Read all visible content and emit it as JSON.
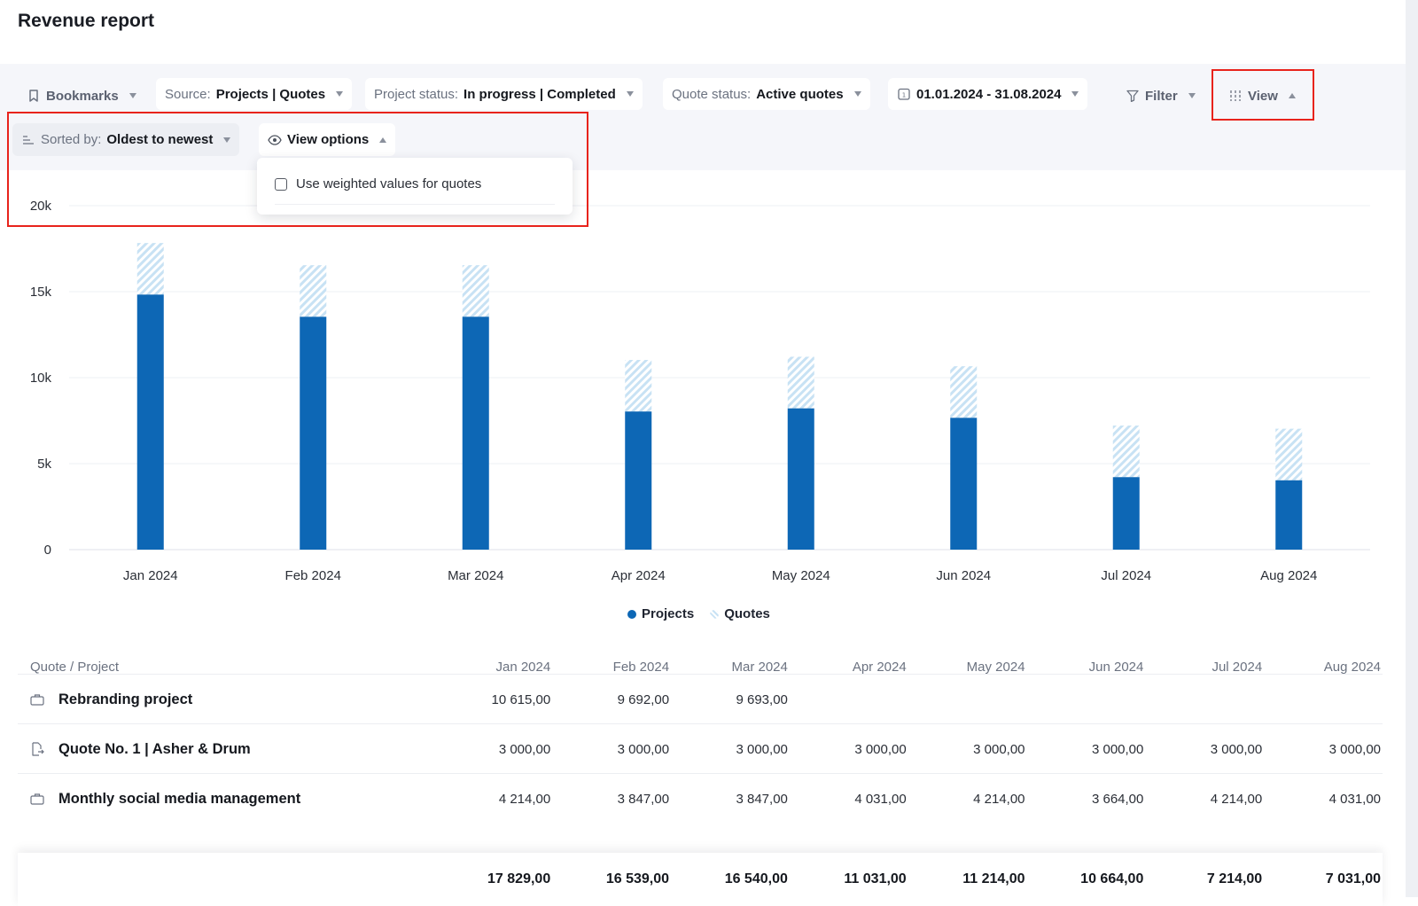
{
  "page": {
    "title": "Revenue report"
  },
  "toolbar": {
    "bookmarks": "Bookmarks",
    "source": {
      "label": "Source:",
      "value": "Projects | Quotes"
    },
    "project_status": {
      "label": "Project status:",
      "value": "In progress | Completed"
    },
    "quote_status": {
      "label": "Quote status:",
      "value": "Active quotes"
    },
    "date_range": "01.01.2024 - 31.08.2024",
    "filter": "Filter",
    "view": "View",
    "sorted_by": {
      "label": "Sorted by:",
      "value": "Oldest to newest"
    },
    "view_options": "View options"
  },
  "view_options_menu": {
    "weighted_option": "Use weighted values for quotes",
    "checked": false
  },
  "colors": {
    "projects": "#0d67b5",
    "quotes": "#c8e2f4",
    "highlight": "#e8231c"
  },
  "chart_data": {
    "type": "bar",
    "stacked": true,
    "categories": [
      "Jan 2024",
      "Feb 2024",
      "Mar 2024",
      "Apr 2024",
      "May 2024",
      "Jun 2024",
      "Jul 2024",
      "Aug 2024"
    ],
    "series": [
      {
        "name": "Projects",
        "values": [
          14829,
          13539,
          13540,
          8031,
          8214,
          7664,
          4214,
          4031
        ]
      },
      {
        "name": "Quotes",
        "values": [
          3000,
          3000,
          3000,
          3000,
          3000,
          3000,
          3000,
          3000
        ]
      }
    ],
    "y_ticks": [
      "0",
      "5k",
      "10k",
      "15k",
      "20k"
    ],
    "ylim": [
      0,
      20000
    ],
    "grid": true,
    "legend": "bottom-center"
  },
  "table": {
    "header": {
      "name": "Quote / Project",
      "months": [
        "Jan 2024",
        "Feb 2024",
        "Mar 2024",
        "Apr 2024",
        "May 2024",
        "Jun 2024",
        "Jul 2024",
        "Aug 2024"
      ]
    },
    "rows": [
      {
        "icon": "briefcase-icon",
        "name": "Rebranding project",
        "values": [
          "10 615,00",
          "9 692,00",
          "9 693,00",
          "",
          "",
          "",
          "",
          ""
        ]
      },
      {
        "icon": "quote-document-icon",
        "name": "Quote No. 1 | Asher & Drum",
        "values": [
          "3 000,00",
          "3 000,00",
          "3 000,00",
          "3 000,00",
          "3 000,00",
          "3 000,00",
          "3 000,00",
          "3 000,00"
        ]
      },
      {
        "icon": "briefcase-icon",
        "name": "Monthly social media management",
        "values": [
          "4 214,00",
          "3 847,00",
          "3 847,00",
          "4 031,00",
          "4 214,00",
          "3 664,00",
          "4 214,00",
          "4 031,00"
        ]
      }
    ],
    "totals": [
      "17 829,00",
      "16 539,00",
      "16 540,00",
      "11 031,00",
      "11 214,00",
      "10 664,00",
      "7 214,00",
      "7 031,00"
    ]
  }
}
